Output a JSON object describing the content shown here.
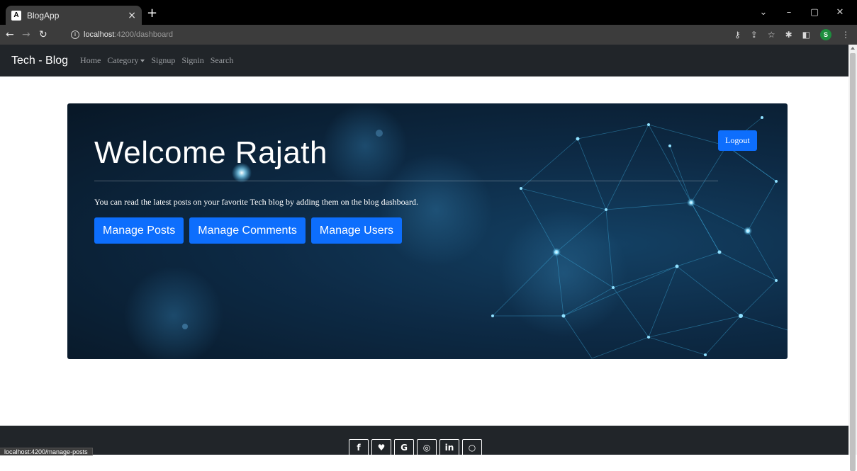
{
  "browser": {
    "tab_favicon": "A",
    "tab_title": "BlogApp",
    "tab_close": "×",
    "new_tab": "+",
    "url_host": "localhost",
    "url_path": ":4200/dashboard",
    "profile_initial": "S",
    "status_url": "localhost:4200/manage-posts"
  },
  "navbar": {
    "brand": "Tech - Blog",
    "links": [
      "Home",
      "Category",
      "Signup",
      "Signin",
      "Search"
    ]
  },
  "hero": {
    "title": "Welcome Rajath",
    "lead": "You can read the latest posts on your favorite Tech blog by adding them on the blog dashboard.",
    "buttons": [
      "Manage Posts",
      "Manage Comments",
      "Manage Users"
    ],
    "logout": "Logout",
    "background_colors": [
      "#081726",
      "#134063",
      "#4fc3f7"
    ]
  },
  "footer": {
    "social_icons": [
      "facebook-icon",
      "twitter-icon",
      "google-icon",
      "instagram-icon",
      "linkedin-icon",
      "github-icon"
    ],
    "social_glyphs": [
      "f",
      "♥",
      "G",
      "◎",
      "in",
      "○"
    ]
  },
  "colors": {
    "navbar": "#212529",
    "primary": "#0d6efd",
    "chrome": "#3c3c3c"
  }
}
